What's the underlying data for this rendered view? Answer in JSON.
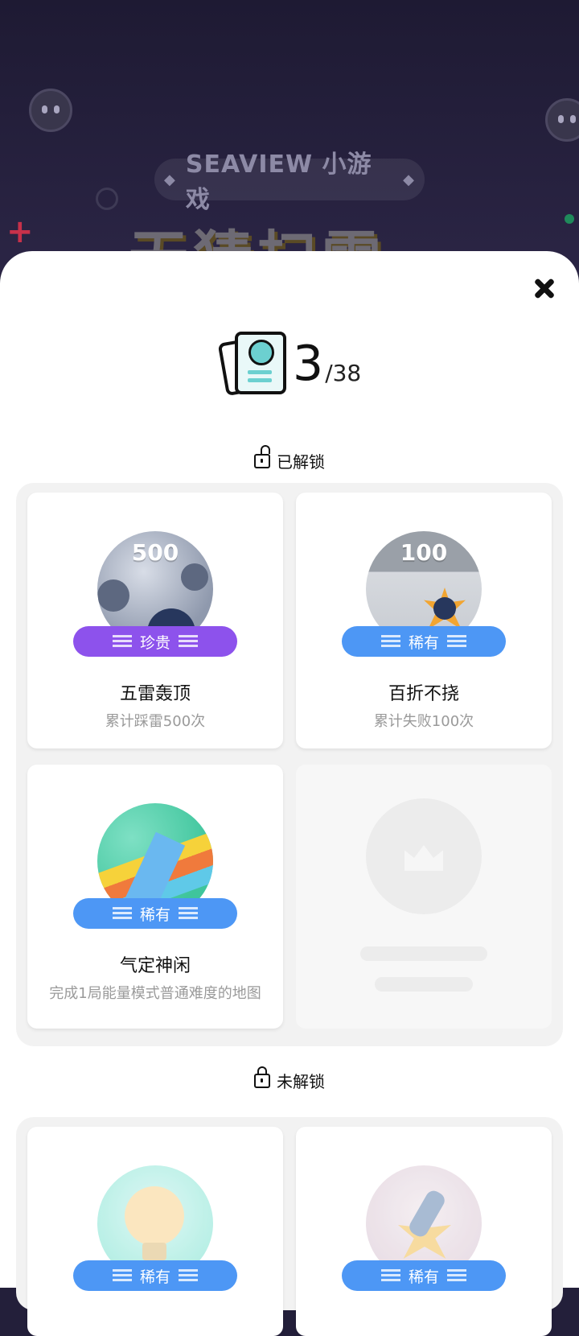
{
  "background": {
    "subtitle": "SEAVIEW 小游戏",
    "diamond": "◆",
    "title": "无猜扫雷"
  },
  "counter": {
    "unlocked": "3",
    "total": "/38"
  },
  "unlocked_section": {
    "title": "已解锁"
  },
  "locked_section": {
    "title": "未解锁"
  },
  "unlocked_cards": [
    {
      "number": "500",
      "rarity": "珍贵",
      "title": "五雷轰顶",
      "desc": "累计踩雷500次"
    },
    {
      "number": "100",
      "rarity": "稀有",
      "title": "百折不挠",
      "desc": "累计失败100次"
    },
    {
      "rarity": "稀有",
      "title": "气定神闲",
      "desc": "完成1局能量模式普通难度的地图"
    }
  ],
  "locked_cards": [
    {
      "rarity": "稀有"
    },
    {
      "rarity": "稀有"
    }
  ]
}
